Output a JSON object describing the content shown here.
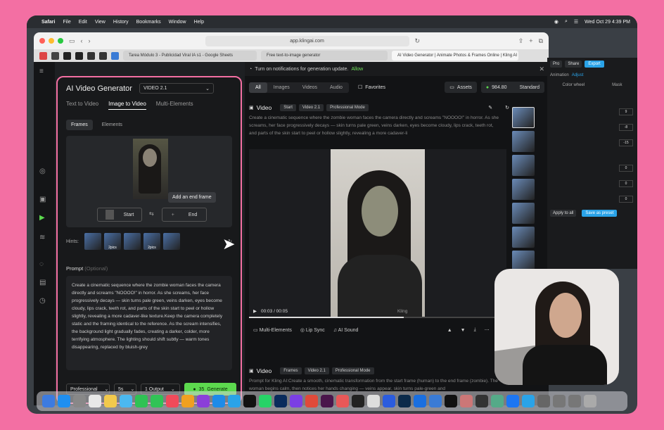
{
  "menubar": {
    "items": [
      "Safari",
      "File",
      "Edit",
      "View",
      "History",
      "Bookmarks",
      "Window",
      "Help"
    ],
    "clock": "Wed Oct 29  4:39 PM"
  },
  "browser": {
    "url": "app.klingai.com",
    "tabs": [
      "Tarea Módulo 3 - Publicidad Viral IA s1 - Google Sheets",
      "Free text-to-image generator",
      "AI Video Generator | Animate Photos & Frames Online | Kling AI"
    ]
  },
  "panel": {
    "title": "AI Video Generator",
    "model": "VIDEO 2.1",
    "modes": [
      "Text to Video",
      "Image to Video",
      "Multi-Elements"
    ],
    "subtabs": [
      "Frames",
      "Elements"
    ],
    "start_label": "Start",
    "end_label": "End",
    "tooltip": "Add an end frame",
    "hints_label": "Hints:",
    "hint_badges": [
      "2pics",
      "2pics"
    ],
    "prompt_label": "Prompt",
    "prompt_optional": "(Optional)",
    "prompt_text": "Create a cinematic sequence where the zombie woman faces the camera directly and screams \"NOOOO!\" in horror. As she screams, her face progressively decays — skin turns pale green, veins darken, eyes become cloudy, lips crack, teeth rot, and parts of the skin start to peel or hollow slightly, revealing a more cadaver-like texture.Keep the camera completely static and the framing identical to the reference. As the scream intensifies, the background light gradually fades, creating a darker, colder, more terrifying atmosphere. The lighting should shift subtly — warm tones disappearing, replaced by bluish-grey",
    "mode_select": "Professional",
    "duration_select": "5s",
    "output_select": "1 Output",
    "generate_cost": "35",
    "generate_label": "Generate"
  },
  "main": {
    "notification": "Turn on notifications for generation update.",
    "allow_label": "Allow",
    "filters": [
      "All",
      "Images",
      "Videos",
      "Audio"
    ],
    "favorites_label": "Favorites",
    "assets_label": "Assets",
    "credits": "984.80",
    "plan": "Standard",
    "video_label": "Video",
    "tag_start": "Start",
    "tag_model": "Video 2.1",
    "tag_mode": "Professional Mode",
    "video_desc": "Create a cinematic sequence where the zombie woman faces the camera directly and screams \"NOOOO!\" in horror. As she screams, her face progressively decays — skin turns pale green, veins darken, eyes become cloudy, lips crack, teeth rot, and parts of the skin start to peel or hollow slightly, revealing a more cadaver-li",
    "time": "00:03 / 00:05",
    "watermark": "Kling",
    "progress": 0.6,
    "actions": [
      "Multi-Elements",
      "Lip Sync",
      "AI Sound"
    ],
    "video2_label": "Video",
    "tag2_frames": "Frames",
    "tag2_model": "Video 2.1",
    "tag2_mode": "Professional Mode",
    "video2_desc": "Prompt for Kling AI:Create a smooth, cinematic transformation from the start frame (human) to the end frame (zombie). The woman begins calm, then notices her hands changing — veins appear, skin turns pale-green and"
  },
  "editor": {
    "top": [
      "Pro",
      "Share",
      "Export"
    ],
    "tabs": [
      "Animation",
      "Adjust"
    ],
    "subtabs": [
      "Color wheel",
      "Mask"
    ],
    "values": [
      "9",
      "-8",
      "-15",
      "0",
      "0",
      "0"
    ],
    "apply_all": "Apply to all",
    "save_preset": "Save as preset"
  },
  "colors": {
    "frame_border": "#f36fa3",
    "generate": "#5cd94e",
    "allow": "#6fe05a",
    "export": "#2aa3e8"
  }
}
